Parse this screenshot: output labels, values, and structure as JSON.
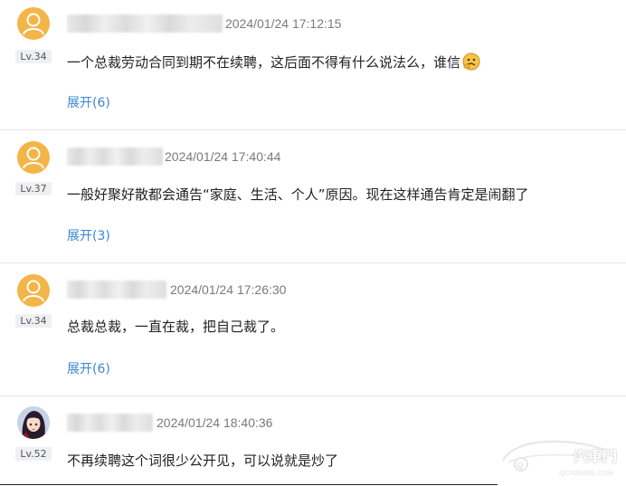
{
  "comments": [
    {
      "level": "Lv.34",
      "time": "2024/01/24 17:12:15",
      "text": "一个总裁劳动合同到期不在续聘，这后面不得有什么说法么，谁信",
      "expand": "展开(6)"
    },
    {
      "level": "Lv.37",
      "time": "2024/01/24 17:40:44",
      "text": "一般好聚好散都会通告“家庭、生活、个人”原因。现在这样通告肯定是闹翻了",
      "expand": "展开(3)"
    },
    {
      "level": "Lv.34",
      "time": "2024/01/24 17:26:30",
      "text": "总裁总裁，一直在裁，把自己裁了。",
      "expand": "展开(6)"
    },
    {
      "level": "Lv.52",
      "time": "2024/01/24 18:40:36",
      "text": "不再续聘这个词很少公开见，可以说就是炒了"
    }
  ],
  "watermark": {
    "brand": "汽車門",
    "sub": "QCHEMEN.COM"
  },
  "colors": {
    "link": "#3a87d6",
    "avatar_default": "#f3b548"
  }
}
